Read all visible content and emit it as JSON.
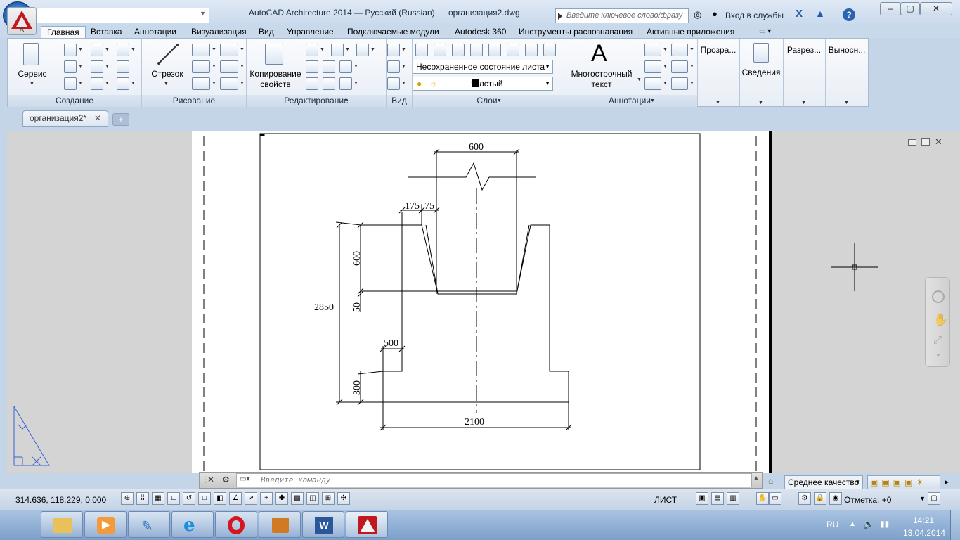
{
  "window": {
    "title": "AutoCAD Architecture 2014 — Русский (Russian)",
    "filename": "организация2.dwg",
    "app_letter": "A",
    "search_placeholder": "Введите ключевое слово/фразу",
    "sign_in": "Вход в службы",
    "help": "?"
  },
  "menu_tabs": [
    "Главная",
    "Вставка",
    "Аннотации",
    "Визуализация",
    "Вид",
    "Управление",
    "Подключаемые модули",
    "Autodesk 360",
    "Инструменты распознавания",
    "Активные приложения"
  ],
  "ribbon": {
    "panels": {
      "create": "Создание",
      "draw": "Рисование",
      "modify": "Редактирование",
      "view": "Вид",
      "layers": "Слои",
      "annotations": "Аннотации"
    },
    "service": "Сервис",
    "segment": "Отрезок",
    "copy_props_1": "Копирование",
    "copy_props_2": "свойств",
    "layer_state": "Несохраненное состояние листа",
    "layer_name": "толстый",
    "mtext_icon": "A",
    "mtext_1": "Многострочный",
    "mtext_2": "текст",
    "transparency": "Прозра...",
    "info": "Сведения",
    "cuts": "Разрез...",
    "callouts": "Выносн..."
  },
  "document_tab": "организация2*",
  "drawing": {
    "dims": {
      "top": "600",
      "small": "175",
      "small2": "75",
      "h600": "600",
      "h50": "50",
      "total": "2850",
      "step": "500",
      "h300": "300",
      "base": "2100"
    }
  },
  "command_line": {
    "placeholder": "Введите команду"
  },
  "status": {
    "coords": "314.636, 118.229, 0.000",
    "sheet": "ЛИСТ",
    "quality": "Среднее качество",
    "annot_scale": "Отметка: +0"
  },
  "tray": {
    "lang": "RU",
    "time": "14:21",
    "date": "13.04.2014"
  },
  "colors": {
    "accent": "#c0181e",
    "cad_bg": "#ffffff",
    "ribbon": "#e8eef6"
  }
}
